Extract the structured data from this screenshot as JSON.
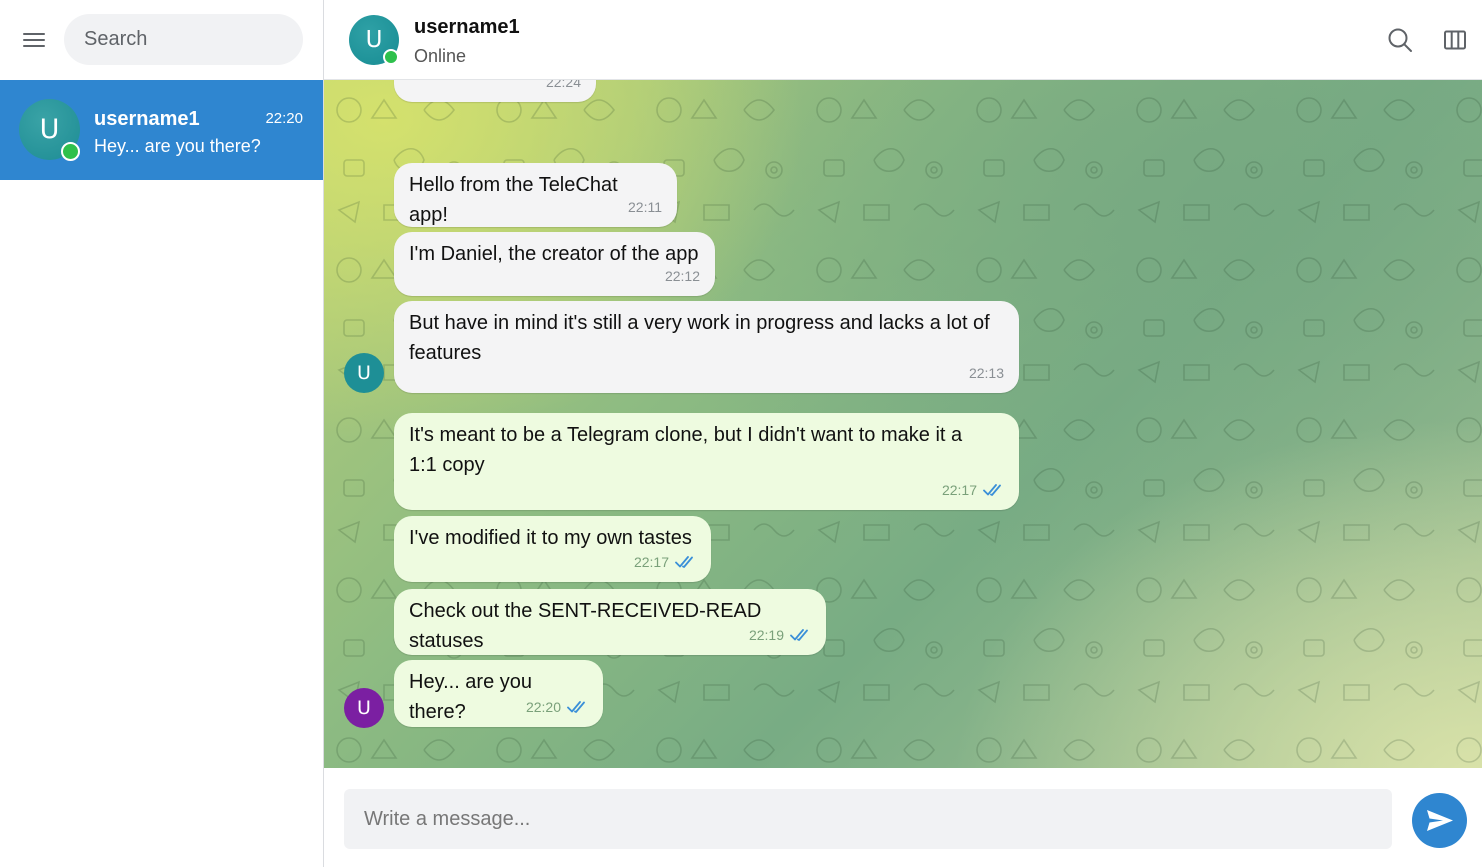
{
  "sidebar": {
    "search_placeholder": "Search",
    "chats": [
      {
        "avatar_letter": "U",
        "name": "username1",
        "time": "22:20",
        "preview": "Hey... are you there?",
        "online": true,
        "selected": true
      }
    ]
  },
  "header": {
    "avatar_letter": "U",
    "name": "username1",
    "status": "Online",
    "icons": [
      "search-icon",
      "columns-icon"
    ]
  },
  "messages": [
    {
      "text": "",
      "time": "22:24",
      "direction": "in",
      "partial": true
    },
    {
      "text": "Hello from the TeleChat app!",
      "time": "22:11",
      "direction": "in"
    },
    {
      "text": "I'm Daniel, the creator of the app",
      "time": "22:12",
      "direction": "in"
    },
    {
      "text": "But have in mind it's still a very work in progress and lacks a lot of features",
      "time": "22:13",
      "direction": "in",
      "avatar_letter": "U",
      "avatar_color": "#1e8f96"
    },
    {
      "text": "It's meant to be a Telegram clone, but I didn't want to make it a 1:1 copy",
      "time": "22:17",
      "direction": "out",
      "status": "read"
    },
    {
      "text": "I've modified it to my own tastes",
      "time": "22:17",
      "direction": "out",
      "status": "read"
    },
    {
      "text": "Check out the SENT-RECEIVED-READ statuses",
      "time": "22:19",
      "direction": "out",
      "status": "read"
    },
    {
      "text": "Hey... are you there?",
      "time": "22:20",
      "direction": "out",
      "status": "read",
      "avatar_letter": "U",
      "avatar_color": "#7b1fa2"
    }
  ],
  "composer": {
    "placeholder": "Write a message...",
    "send_icon": "send-icon"
  },
  "colors": {
    "accent": "#2f86d0",
    "online": "#2ec04c",
    "incoming_bubble": "#f4f4f5",
    "outgoing_bubble": "#eefbe0",
    "read_check": "#3a8fd8"
  }
}
